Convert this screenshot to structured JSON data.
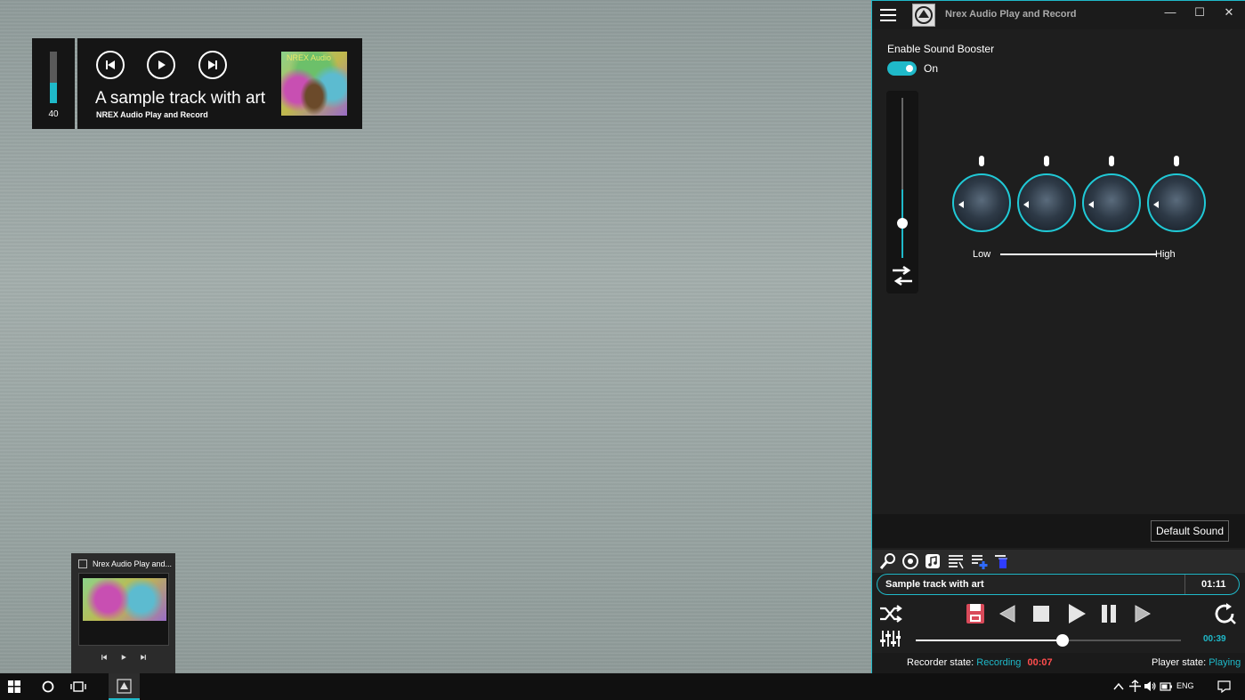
{
  "overlay": {
    "volume": "40",
    "volume_level": 0.4,
    "track_title": "A sample track with art",
    "app_name": "NREX Audio Play and Record",
    "album_text": "NREX Audio"
  },
  "preview": {
    "title": "Nrex Audio Play and..."
  },
  "app": {
    "title": "Nrex Audio Play and Record",
    "win_minimize": "—",
    "win_maximize": "☐",
    "win_close": "✕",
    "booster_label": "Enable Sound Booster",
    "toggle_state": "On",
    "booster_level": 0.43,
    "low_label": "Low",
    "high_label": "High",
    "default_sound_label": "Default Sound",
    "track_name": "Sample track with art",
    "track_duration": "01:11",
    "position_time": "00:39",
    "position_fraction": 0.56,
    "recorder_label": "Recorder state:",
    "recorder_value": "Recording",
    "recorder_time": "00:07",
    "player_label": "Player state:",
    "player_value": "Playing"
  },
  "tray": {
    "language": "ENG"
  },
  "colors": {
    "accent": "#1fb9c9",
    "record_time": "#ff4d4d"
  }
}
